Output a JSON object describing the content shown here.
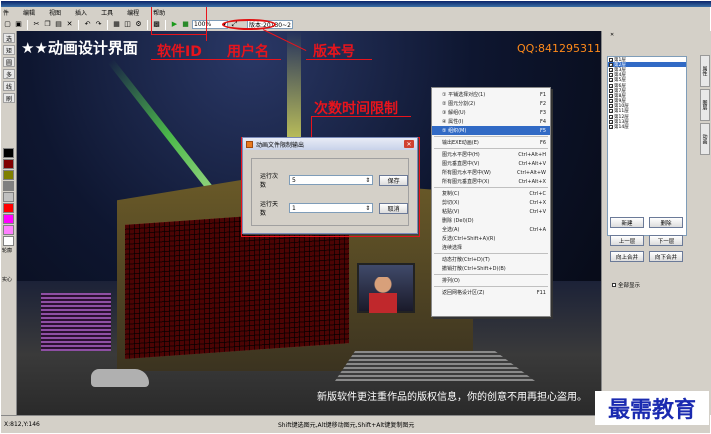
{
  "menubar": [
    "件",
    "编辑",
    "视图",
    "插入",
    "工具",
    "编程",
    "帮助"
  ],
  "toolbar": {
    "icons": [
      "new-icon",
      "save-icon",
      "cut-icon",
      "copy-icon",
      "paste-icon",
      "delete-icon",
      "undo-icon",
      "redo-icon",
      "grid-icon",
      "layer-icon",
      "settings-icon",
      "play-icon",
      "record-icon"
    ],
    "zoom": "100%",
    "version": "版本:20130~2"
  },
  "left_tools": [
    "选",
    "矩",
    "圆",
    "多",
    "线",
    "刷"
  ],
  "left_colors": [
    "#000000",
    "#800000",
    "#808000",
    "#808080",
    "#c0c0c0",
    "#ff0000",
    "#ff00ff",
    "#ff80ff",
    "#ffffff"
  ],
  "left_labels": {
    "outline": "轮廓",
    "fill": "实心"
  },
  "canvas": {
    "title": "★★动画设计界面",
    "qq": "QQ:841295311",
    "notice": "新版软件更注重作品的版权信息，你的创意不用再担心盗用。"
  },
  "annotations": {
    "software_id": "软件ID",
    "username": "用户名",
    "version_no": "版本号",
    "limit": "次数时间限制"
  },
  "dialog": {
    "title": "动画文件限制输出",
    "close": "✕",
    "runs_label": "运行次数",
    "runs_value": "5",
    "days_label": "运行天数",
    "days_value": "1",
    "save": "保存",
    "cancel": "取消"
  },
  "context_menu": [
    {
      "label": "① 平铺选择对应(1)",
      "key": "F1"
    },
    {
      "label": "② 图元分割(2)",
      "key": "F2"
    },
    {
      "label": "③ 解组(U)",
      "key": "F3"
    },
    {
      "label": "④ 属性(I)",
      "key": "F4"
    },
    {
      "label": "⑤ 组织(M)",
      "key": "F5",
      "highlight": true
    },
    {
      "sep": true
    },
    {
      "label": "输出EXE动画(E)",
      "key": "F6"
    },
    {
      "sep": true
    },
    {
      "label": "图元水平居中(H)",
      "key": "Ctrl+Alt+H"
    },
    {
      "label": "图元垂直居中(V)",
      "key": "Ctrl+Alt+V"
    },
    {
      "label": "所有图元水平居中(W)",
      "key": "Ctrl+Alt+W"
    },
    {
      "label": "所有图元垂直居中(X)",
      "key": "Ctrl+Alt+X"
    },
    {
      "sep": true
    },
    {
      "label": "复制(C)",
      "key": "Ctrl+C"
    },
    {
      "label": "剪切(X)",
      "key": "Ctrl+X"
    },
    {
      "label": "粘贴(V)",
      "key": "Ctrl+V"
    },
    {
      "label": "删除  (Del)(D)",
      "key": ""
    },
    {
      "label": "全选(A)",
      "key": "Ctrl+A"
    },
    {
      "label": "反选(Ctrl+Shift+A)(R)",
      "key": ""
    },
    {
      "label": "连续选择",
      "key": ""
    },
    {
      "sep": true
    },
    {
      "label": "动态打散(Ctrl+D)(T)",
      "key": ""
    },
    {
      "label": "撤销打散(Ctrl+Shift+D)(B)",
      "key": ""
    },
    {
      "sep": true
    },
    {
      "label": "排列(O)",
      "key": ""
    },
    {
      "sep": true
    },
    {
      "label": "返回网格设计区(Z)",
      "key": "F11"
    }
  ],
  "layers": [
    {
      "label": "第1层",
      "sel": false
    },
    {
      "label": "第2层",
      "sel": true
    },
    {
      "label": "第3层",
      "sel": false
    },
    {
      "label": "第4层",
      "sel": false
    },
    {
      "label": "第5层",
      "sel": false
    },
    {
      "label": "第6层",
      "sel": false
    },
    {
      "label": "第7层",
      "sel": false
    },
    {
      "label": "第8层",
      "sel": false
    },
    {
      "label": "第9层",
      "sel": false
    },
    {
      "label": "第10层",
      "sel": false
    },
    {
      "label": "第11层",
      "sel": false
    },
    {
      "label": "第12层",
      "sel": false
    },
    {
      "label": "第13层",
      "sel": false
    },
    {
      "label": "第14层",
      "sel": false
    }
  ],
  "right_tabs": [
    "属性",
    "图层",
    "动画"
  ],
  "right_buttons": {
    "new": "新建",
    "delete": "删除",
    "up": "上一层",
    "down": "下一层",
    "merge_up": "向上合并",
    "merge_down": "向下合并",
    "show_all": "全部显示"
  },
  "status": {
    "coords": "X:812,Y:146",
    "hint": "Shift键选图元,Alt键移动图元,Shift+Alt键复制图元"
  },
  "watermark": "最需教育"
}
